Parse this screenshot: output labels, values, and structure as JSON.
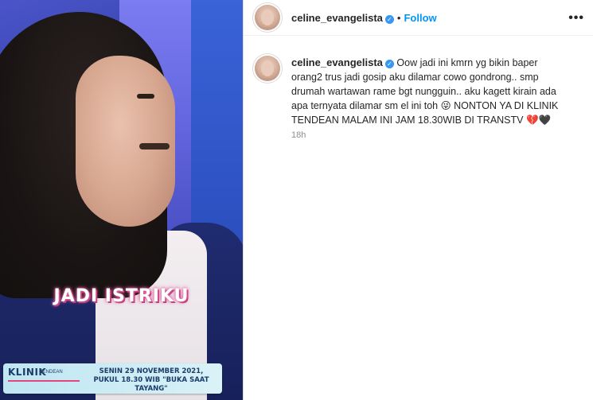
{
  "media": {
    "caption": "JADI ISTRIKU",
    "banner": {
      "logo": "KLINIK",
      "logo_sub": "TENDEAN",
      "line1": "SENIN 29 NOVEMBER 2021,",
      "line2": "PUKUL 18.30 WIB \"BUKA SAAT TAYANG\""
    }
  },
  "header": {
    "username": "celine_evangelista",
    "verified_icon": "verified-badge-icon",
    "separator": "•",
    "follow_label": "Follow",
    "more_label": "•••"
  },
  "post": {
    "username": "celine_evangelista",
    "caption": "Oow jadi ini kmrn yg bikin baper orang2 trus jadi gosip aku dilamar cowo gondrong.. smp drumah wartawan rame bgt nungguin.. aku kagett kirain ada apa ternyata dilamar sm el ini toh 😜 NONTON YA DI KLINIK TENDEAN MALAM INI JAM 18.30WIB DI TRANSTV 💔🖤",
    "time": "18h"
  },
  "colors": {
    "accent": "#0095f6",
    "verified": "#3897f0",
    "text": "#262626",
    "muted": "#8e8e8e"
  }
}
